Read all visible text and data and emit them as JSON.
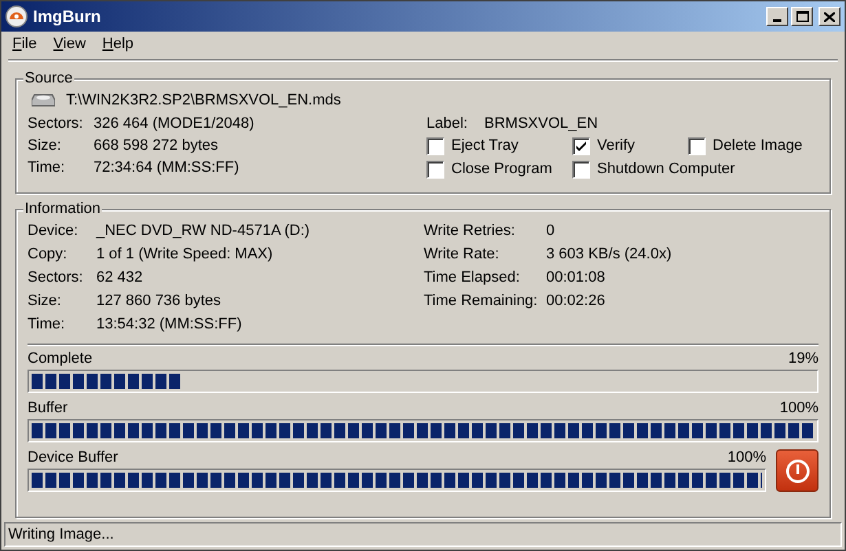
{
  "window": {
    "title": "ImgBurn"
  },
  "menu": [
    "File",
    "View",
    "Help"
  ],
  "source": {
    "title": "Source",
    "file": "T:\\WIN2K3R2.SP2\\BRMSXVOL_EN.mds",
    "fields": [
      {
        "label": "Sectors:",
        "value": "326 464 (MODE1/2048)"
      },
      {
        "label": "Size:",
        "value": "668 598 272 bytes"
      },
      {
        "label": "Time:",
        "value": "72:34:64 (MM:SS:FF)"
      }
    ],
    "label": {
      "label": "Label:",
      "value": "BRMSXVOL_EN"
    },
    "options": [
      {
        "label": "Eject Tray",
        "checked": false
      },
      {
        "label": "Verify",
        "checked": true
      },
      {
        "label": "Delete Image",
        "checked": false
      },
      {
        "label": "Close Program",
        "checked": false
      },
      {
        "label": "Shutdown Computer",
        "checked": false
      }
    ]
  },
  "information": {
    "title": "Information",
    "left": [
      {
        "label": "Device:",
        "value": "_NEC DVD_RW ND-4571A (D:)"
      },
      {
        "label": "Copy:",
        "value": "1 of 1 (Write Speed: MAX)"
      },
      {
        "label": "Sectors:",
        "value": "62 432"
      },
      {
        "label": "Size:",
        "value": "127 860 736 bytes"
      },
      {
        "label": "Time:",
        "value": "13:54:32 (MM:SS:FF)"
      }
    ],
    "right": [
      {
        "label": "Write Retries:",
        "value": "0"
      },
      {
        "label": "Write Rate:",
        "value": "3 603 KB/s (24.0x)"
      },
      {
        "label": "Time Elapsed:",
        "value": "00:01:08"
      },
      {
        "label": "Time Remaining:",
        "value": "00:02:26"
      }
    ],
    "progress": [
      {
        "label": "Complete",
        "reading": "19%",
        "level": 0.19
      },
      {
        "label": "Buffer",
        "reading": "100%",
        "level": 1.0
      },
      {
        "label": "Device Buffer",
        "reading": "100%",
        "level": 1.0
      }
    ]
  },
  "status_bar": "Writing Image..."
}
